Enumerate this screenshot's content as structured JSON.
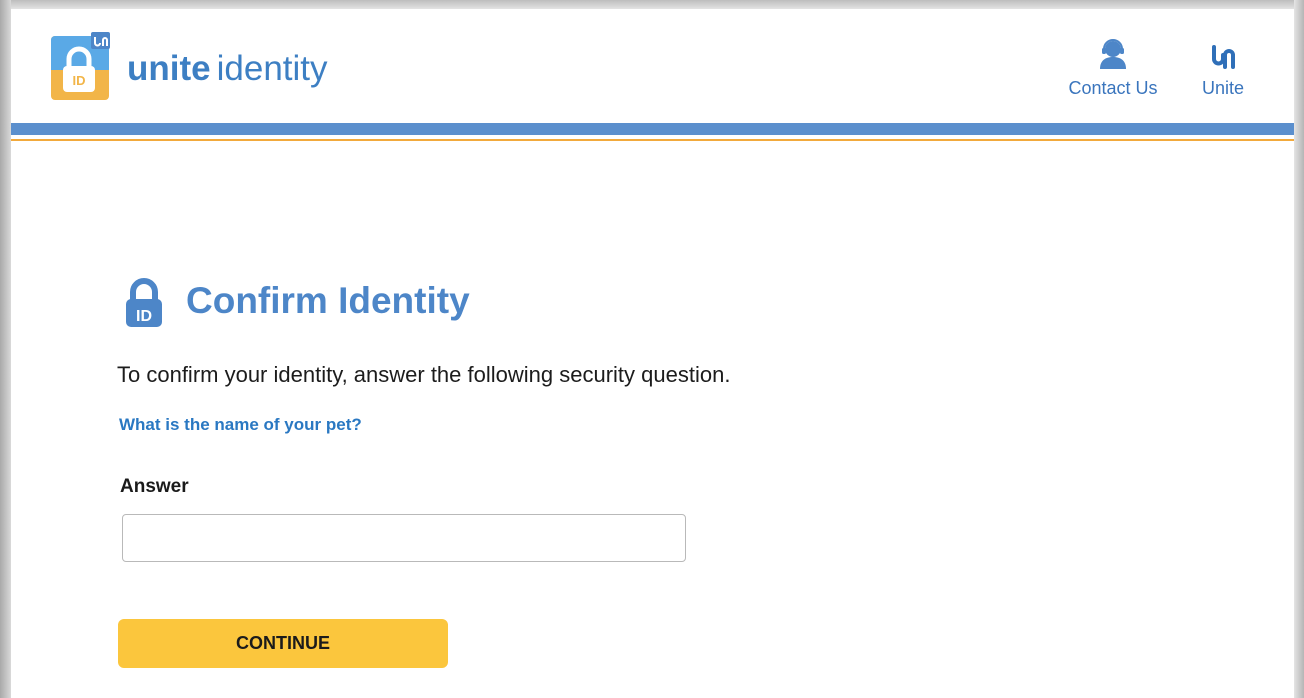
{
  "header": {
    "brand_bold": "unite",
    "brand_regular": "identity",
    "contact_label": "Contact Us",
    "unite_label": "Unite"
  },
  "colors": {
    "brand_blue": "#3d7fc3",
    "header_bar": "#5b8fcd",
    "accent_orange": "#f2a93b",
    "button_yellow": "#fbc63d"
  },
  "icons": {
    "logo": "unite-identity-lock-logo-icon",
    "contact": "person-headset-icon",
    "unite": "unite-logo-icon",
    "title": "lock-id-icon"
  },
  "main": {
    "title": "Confirm Identity",
    "instructions": "To confirm your identity, answer the following security question.",
    "question": "What is the name of your pet?",
    "answer_label": "Answer",
    "answer_value": "",
    "continue_label": "CONTINUE"
  }
}
